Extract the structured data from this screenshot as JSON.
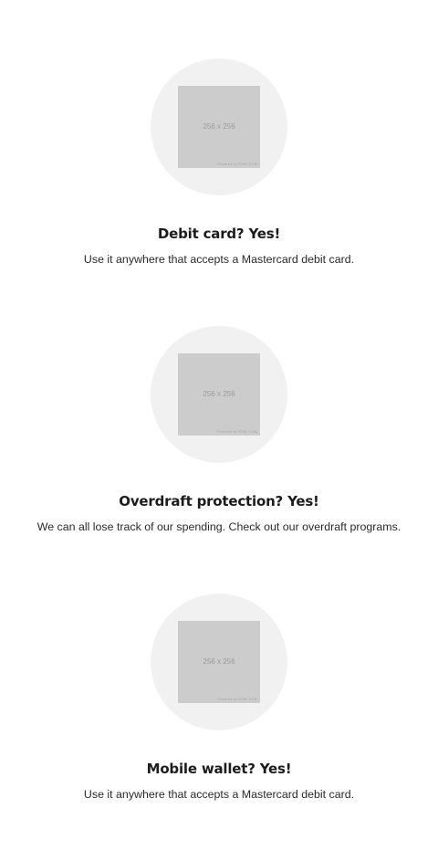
{
  "features": [
    {
      "icon": "image-placeholder-icon",
      "image_label": "256 x 256",
      "image_credit": "Powered by HTML.COM",
      "title": "Debit card? Yes!",
      "description": "Use it anywhere that accepts a Mastercard debit card."
    },
    {
      "icon": "image-placeholder-icon",
      "image_label": "256 x 256",
      "image_credit": "Powered by HTML.COM",
      "title": "Overdraft protection? Yes!",
      "description": "We can all lose track of our spending. Check out our overdraft programs."
    },
    {
      "icon": "image-placeholder-icon",
      "image_label": "256 x 256",
      "image_credit": "Powered by HTML.COM",
      "title": "Mobile wallet? Yes!",
      "description": "Use it anywhere that accepts a Mastercard debit card."
    }
  ],
  "colors": {
    "circle_bg": "#f1f1f1",
    "placeholder_bg": "#cccccc",
    "text": "#1f1f1f"
  }
}
